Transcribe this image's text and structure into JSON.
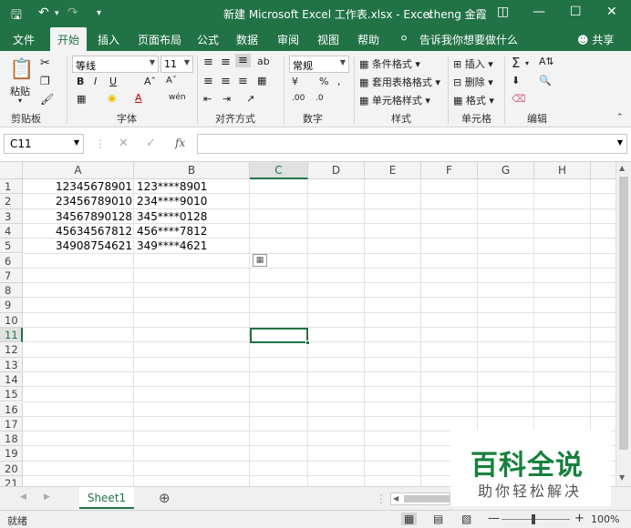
{
  "window": {
    "title": "新建 Microsoft Excel 工作表.xlsx  -  Excel",
    "user": "cheng 金霞"
  },
  "tabs": [
    "文件",
    "开始",
    "插入",
    "页面布局",
    "公式",
    "数据",
    "审阅",
    "视图",
    "帮助"
  ],
  "active_tab": "开始",
  "tell_me": "告诉我你想要做什么",
  "share": "共享",
  "ribbon": {
    "paste": "粘贴",
    "font_name": "等线",
    "font_size": "11",
    "number_format": "常规",
    "conditional_format": "条件格式",
    "table_format": "套用表格格式",
    "cell_style": "单元格样式",
    "insert": "插入",
    "delete": "删除",
    "format": "格式",
    "groups": [
      "剪贴板",
      "字体",
      "对齐方式",
      "数字",
      "样式",
      "单元格",
      "编辑"
    ]
  },
  "formula_bar": {
    "name_box": "C11",
    "fx": "fx",
    "formula": ""
  },
  "grid": {
    "columns": [
      "A",
      "B",
      "C",
      "D",
      "E",
      "F",
      "G",
      "H"
    ],
    "rows": [
      "1",
      "2",
      "3",
      "4",
      "5",
      "6",
      "7",
      "8",
      "9",
      "10",
      "11",
      "12",
      "13",
      "14",
      "15",
      "16",
      "17",
      "18",
      "19",
      "20",
      "21"
    ],
    "active_cell": "C11",
    "data": [
      {
        "a": "12345678901",
        "b": "123****8901"
      },
      {
        "a": "23456789010",
        "b": "234****9010"
      },
      {
        "a": "34567890128",
        "b": "345****0128"
      },
      {
        "a": "45634567812",
        "b": "456****7812"
      },
      {
        "a": "34908754621",
        "b": "349****4621"
      }
    ]
  },
  "sheet_tab": "Sheet1",
  "status": {
    "ready": "就绪",
    "zoom": "100%"
  },
  "watermark": {
    "title": "百科全说",
    "subtitle": "助你轻松解决"
  }
}
